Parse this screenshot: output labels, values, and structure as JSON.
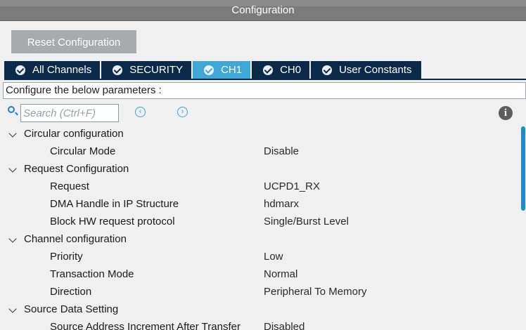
{
  "window": {
    "title": "Configuration"
  },
  "toolbar": {
    "reset_label": "Reset Configuration"
  },
  "tabs": [
    {
      "label": "All Channels",
      "active": false
    },
    {
      "label": "SECURITY",
      "active": false
    },
    {
      "label": "CH1",
      "active": true
    },
    {
      "label": "CH0",
      "active": false
    },
    {
      "label": "User Constants",
      "active": false
    }
  ],
  "instructions": "Configure the below parameters :",
  "search": {
    "placeholder": "Search (Ctrl+F)"
  },
  "nav": {
    "prev": "‹",
    "next": "›"
  },
  "info": {
    "glyph": "i"
  },
  "tree": [
    {
      "kind": "group",
      "label": "Circular configuration"
    },
    {
      "kind": "param",
      "label": "Circular Mode",
      "value": "Disable"
    },
    {
      "kind": "group",
      "label": "Request Configuration"
    },
    {
      "kind": "param",
      "label": "Request",
      "value": "UCPD1_RX"
    },
    {
      "kind": "param",
      "label": "DMA Handle in IP Structure",
      "value": "hdmarx"
    },
    {
      "kind": "param",
      "label": "Block HW request protocol",
      "value": "Single/Burst Level"
    },
    {
      "kind": "group",
      "label": "Channel configuration"
    },
    {
      "kind": "param",
      "label": "Priority",
      "value": "Low"
    },
    {
      "kind": "param",
      "label": "Transaction Mode",
      "value": "Normal"
    },
    {
      "kind": "param",
      "label": "Direction",
      "value": "Peripheral To Memory"
    },
    {
      "kind": "group",
      "label": "Source Data Setting"
    },
    {
      "kind": "param",
      "label": "Source Address Increment After Transfer",
      "value": "Disabled"
    }
  ],
  "colors": {
    "tab_bg": "#0b2a4a",
    "tab_active": "#3fa7d6",
    "accent": "#1e8ad0"
  }
}
